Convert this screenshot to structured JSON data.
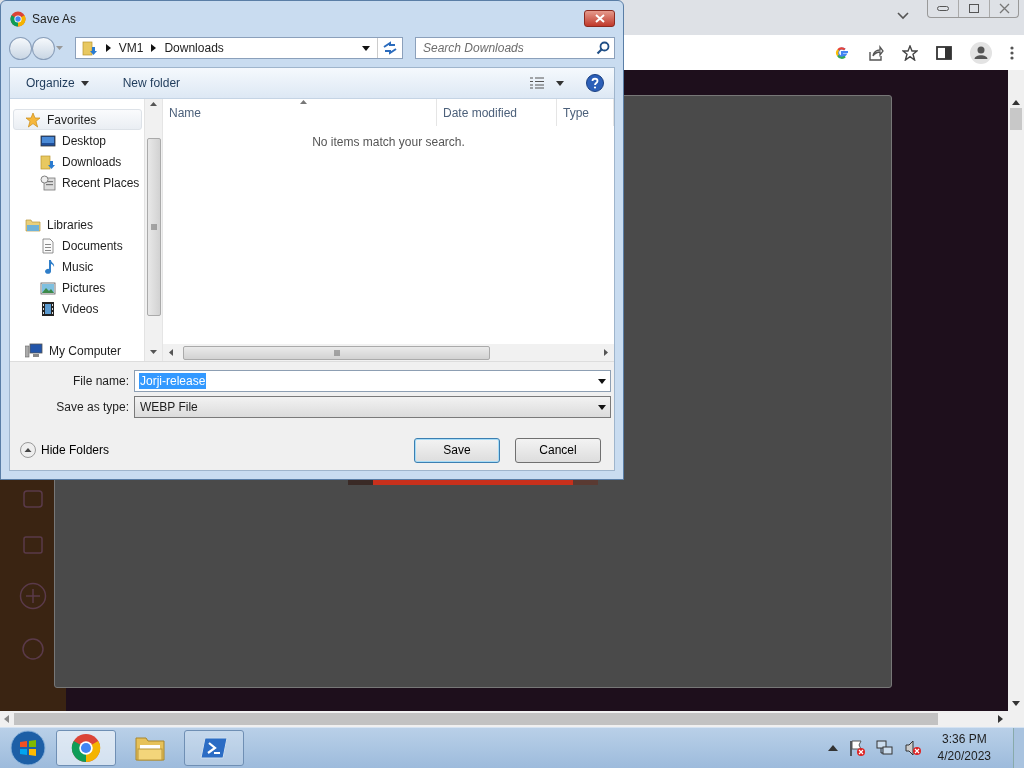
{
  "dialog": {
    "title": "Save As",
    "breadcrumb": [
      "VM1",
      "Downloads"
    ],
    "search": {
      "placeholder": "Search Downloads"
    },
    "toolbar": [
      {
        "label": "Organize",
        "kind": "menu"
      },
      {
        "label": "New folder",
        "kind": "plain"
      }
    ],
    "nav_tree": [
      {
        "label": "Favorites",
        "kind": "star",
        "selected": true,
        "children": [
          {
            "label": "Desktop",
            "kind": "desktop",
            "selected": false
          },
          {
            "label": "Downloads",
            "kind": "downloads",
            "selected": false
          },
          {
            "label": "Recent Places",
            "kind": "recent",
            "selected": false
          }
        ]
      },
      {
        "label": "Libraries",
        "kind": "libraries",
        "selected": false,
        "children": [
          {
            "label": "Documents",
            "kind": "documents",
            "selected": false
          },
          {
            "label": "Music",
            "kind": "music",
            "selected": false
          },
          {
            "label": "Pictures",
            "kind": "pictures",
            "selected": false
          },
          {
            "label": "Videos",
            "kind": "videos",
            "selected": false
          }
        ]
      },
      {
        "label": "My Computer",
        "kind": "computer",
        "selected": false
      }
    ],
    "columns": [
      {
        "label": "Name",
        "sorted": true
      },
      {
        "label": "Date modified",
        "sorted": false
      },
      {
        "label": "Type",
        "sorted": false
      }
    ],
    "empty_message": "No items match your search.",
    "fields": [
      {
        "label": "File name:",
        "value": "Jorji-release",
        "kind": "editable",
        "text_selected": true
      },
      {
        "label": "Save as type:",
        "value": "WEBP File",
        "kind": "dropdown",
        "text_selected": false
      }
    ],
    "hide_folders": "Hide Folders",
    "buttons": [
      {
        "label": "Save",
        "default": true
      },
      {
        "label": "Cancel",
        "default": false
      }
    ]
  },
  "taskbar": {
    "apps": [
      {
        "kind": "chrome",
        "active": true,
        "running": true
      },
      {
        "kind": "explorer",
        "active": false,
        "running": false
      },
      {
        "kind": "powershell",
        "active": false,
        "running": true
      }
    ],
    "time": "3:36 PM",
    "date": "4/20/2023"
  }
}
